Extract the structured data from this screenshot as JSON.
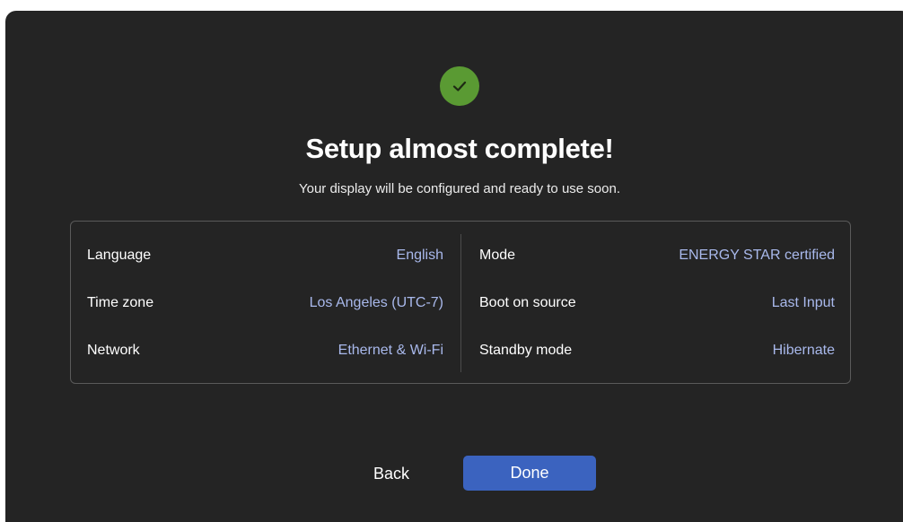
{
  "header": {
    "status_icon": "checkmark-icon",
    "status_color": "#5a9a33",
    "title": "Setup almost complete!",
    "subtitle": "Your display will be configured and ready to use soon."
  },
  "summary": {
    "left": [
      {
        "label": "Language",
        "value": "English"
      },
      {
        "label": "Time zone",
        "value": "Los Angeles (UTC-7)"
      },
      {
        "label": "Network",
        "value": "Ethernet & Wi-Fi"
      }
    ],
    "right": [
      {
        "label": "Mode",
        "value": "ENERGY STAR certified"
      },
      {
        "label": "Boot on source",
        "value": "Last Input"
      },
      {
        "label": "Standby mode",
        "value": "Hibernate"
      }
    ]
  },
  "actions": {
    "back_label": "Back",
    "done_label": "Done",
    "accent_color": "#3b63bf"
  }
}
